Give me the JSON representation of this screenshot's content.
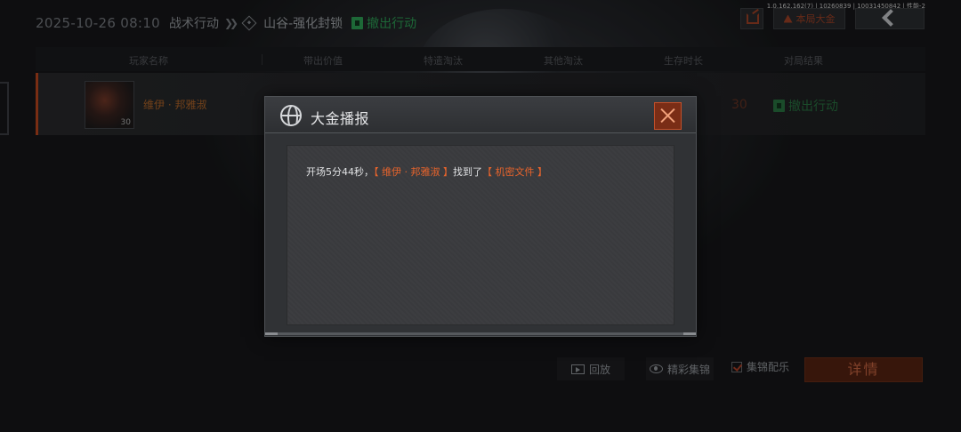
{
  "build_info": "1.0.162.162(7) | 10260839 | 10031450842 | 性能-2",
  "header": {
    "datetime": "2025-10-26 08:10",
    "mode": "战术行动",
    "map": "山谷-强化封锁",
    "status": "撤出行动"
  },
  "toolbar": {
    "jackpot_label": "本局大金"
  },
  "table": {
    "columns": [
      "玩家名称",
      "带出价值",
      "特遣淘汰",
      "其他淘汰",
      "生存时长",
      "对局结果"
    ],
    "rows": [
      {
        "player": "维伊 · 邦雅淑",
        "level": "30",
        "partial_value": "30",
        "result": "撤出行动"
      }
    ]
  },
  "bottom_bar": {
    "replay_label": "回放",
    "highlights_label": "精彩集锦",
    "music_label": "集锦配乐",
    "details_label": "详情"
  },
  "modal": {
    "title": "大金播报",
    "message": {
      "prefix": "开场5分44秒，",
      "player": "【 维伊 · 邦雅淑 】",
      "middle": "找到了",
      "item": "【 机密文件 】"
    }
  },
  "colors": {
    "accent": "#e8642c",
    "success": "#2fa85a",
    "close_bg": "#7a2d16"
  }
}
